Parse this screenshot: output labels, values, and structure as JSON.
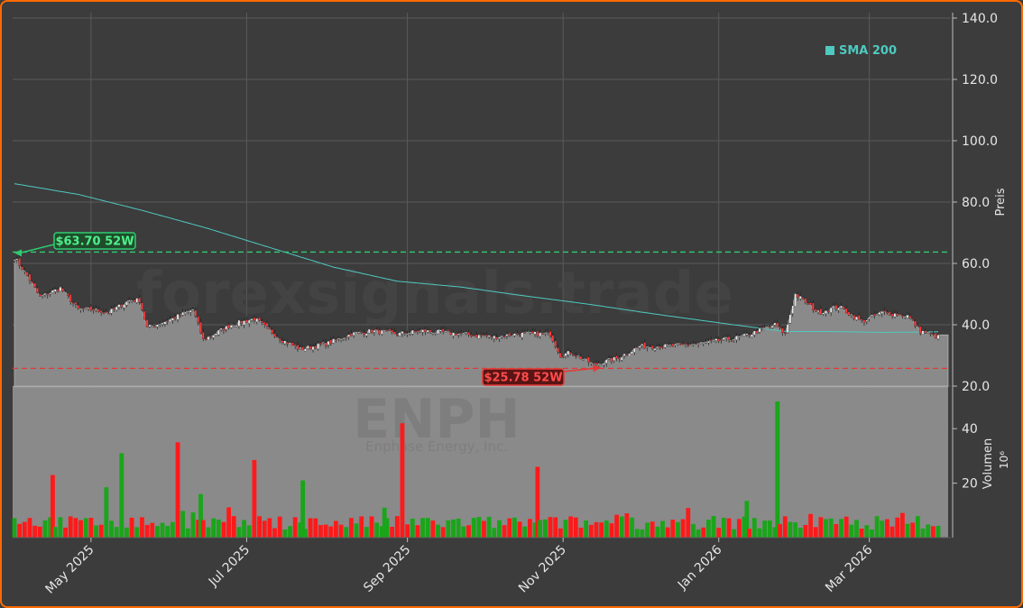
{
  "ticker": "ENPH",
  "company": "Enphase Energy, Inc.",
  "watermark": "forexsignals.trade",
  "colors": {
    "background": "#3c3c3c",
    "frame": "#ff6a00",
    "grid": "#5a5a5a",
    "area": "#8a8a8a",
    "sma": "#4fc9c0",
    "high_line": "#2ecc71",
    "low_line": "#e53935",
    "up": "#1aa51a",
    "down": "#ff1a1a"
  },
  "legend": {
    "sma_label": "SMA 200",
    "position": "top-right"
  },
  "annotations": {
    "high_label": "$63.70 52W",
    "low_label": "$25.78 52W"
  },
  "chart_data": {
    "type": "candlestick+volume",
    "x_tick_labels": [
      "May 2025",
      "Jul 2025",
      "Sep 2025",
      "Nov 2025",
      "Jan 2026",
      "Mar 2026"
    ],
    "x_tick_days": [
      30,
      91,
      154,
      215,
      276,
      335
    ],
    "price_axis": {
      "label": "Preis",
      "ylim": [
        20,
        140
      ],
      "ticks": [
        "20.0",
        "40.0",
        "60.0",
        "80.0",
        "100.0",
        "120.0",
        "140.0"
      ],
      "tick_values": [
        20,
        40,
        60,
        80,
        100,
        120,
        140
      ]
    },
    "volume_axis": {
      "label": "Volumen",
      "unit": "10⁶",
      "ticks": [
        "20",
        "40"
      ],
      "tick_values": [
        20,
        40
      ]
    },
    "high_52w": 63.7,
    "low_52w": 25.78,
    "price_key_days": [
      0,
      5,
      10,
      18,
      25,
      30,
      37,
      45,
      49,
      52,
      62,
      70,
      74,
      76,
      85,
      94,
      105,
      112,
      123,
      132,
      140,
      150,
      160,
      175,
      188,
      197,
      210,
      214,
      218,
      227,
      236,
      245,
      257,
      270,
      285,
      298,
      302,
      306,
      315,
      323,
      332,
      340,
      350,
      355,
      362
    ],
    "price_key_close": [
      62,
      56,
      49,
      52,
      45,
      45,
      44,
      48,
      48,
      39,
      42,
      45,
      35,
      36,
      40,
      42,
      35,
      32,
      34,
      37,
      38,
      37,
      38,
      37,
      36,
      37,
      37,
      30,
      31,
      27,
      29,
      33,
      33,
      34,
      36,
      40,
      37,
      50,
      44,
      46,
      41,
      44,
      43,
      38,
      36
    ],
    "sma200_key_days": [
      0,
      25,
      50,
      75,
      100,
      125,
      150,
      175,
      200,
      225,
      250,
      280,
      302,
      320,
      340,
      362
    ],
    "sma200_key_values": [
      86,
      82.5,
      77.3,
      71.6,
      65.2,
      58.8,
      54.2,
      52.3,
      49.4,
      46.7,
      43.6,
      40.2,
      37.8,
      37.8,
      37.5,
      37.7
    ],
    "volume_spikes_millions": [
      {
        "day": 15,
        "value": 23,
        "dir": "down"
      },
      {
        "day": 36,
        "value": 18.5,
        "dir": "up"
      },
      {
        "day": 42,
        "value": 31,
        "dir": "up"
      },
      {
        "day": 64,
        "value": 35,
        "dir": "down"
      },
      {
        "day": 73,
        "value": 16,
        "dir": "up"
      },
      {
        "day": 94,
        "value": 28.5,
        "dir": "down"
      },
      {
        "day": 113,
        "value": 21,
        "dir": "up"
      },
      {
        "day": 145,
        "value": 11,
        "dir": "up"
      },
      {
        "day": 152,
        "value": 42,
        "dir": "down"
      },
      {
        "day": 205,
        "value": 26,
        "dir": "down"
      },
      {
        "day": 287,
        "value": 13.5,
        "dir": "up"
      },
      {
        "day": 299,
        "value": 50,
        "dir": "up"
      }
    ]
  }
}
